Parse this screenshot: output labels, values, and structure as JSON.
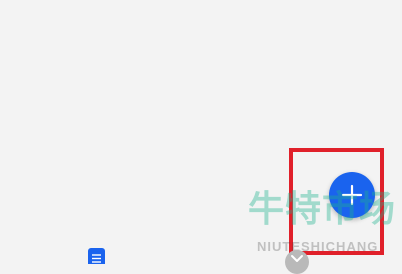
{
  "fab": {
    "icon": "plus-icon",
    "color": "#1a63ee"
  },
  "highlight": {
    "color": "#e0202a"
  },
  "watermark": {
    "chinese": "牛特市场",
    "latin": "NIUTESHICHANG"
  },
  "bottom_nav": {
    "items": [
      {
        "icon": "document-icon",
        "color": "#1a63ee"
      },
      {
        "icon": "check-icon",
        "color": "#b9b9b9"
      }
    ]
  }
}
